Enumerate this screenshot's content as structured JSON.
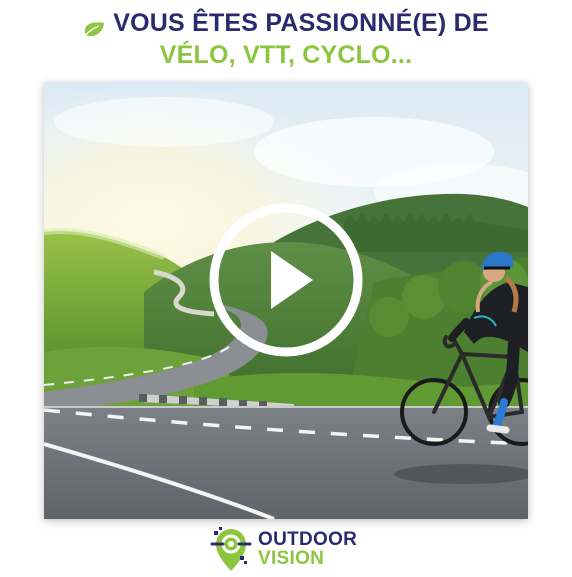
{
  "header": {
    "line1": "VOUS ÊTES PASSIONNÉ(E) DE",
    "line2": "VÉLO, VTT, CYCLO...",
    "bullet_icon": "leaf-icon"
  },
  "video": {
    "thumbnail": "cyclist-on-mountain-road",
    "play_icon": "play-icon"
  },
  "brand": {
    "logo_icon": "map-pin-target-icon",
    "name_line1": "OUTDOOR",
    "name_line2": "VISION"
  },
  "colors": {
    "navy": "#2c2a6e",
    "green": "#8cc63f",
    "white": "#ffffff"
  }
}
